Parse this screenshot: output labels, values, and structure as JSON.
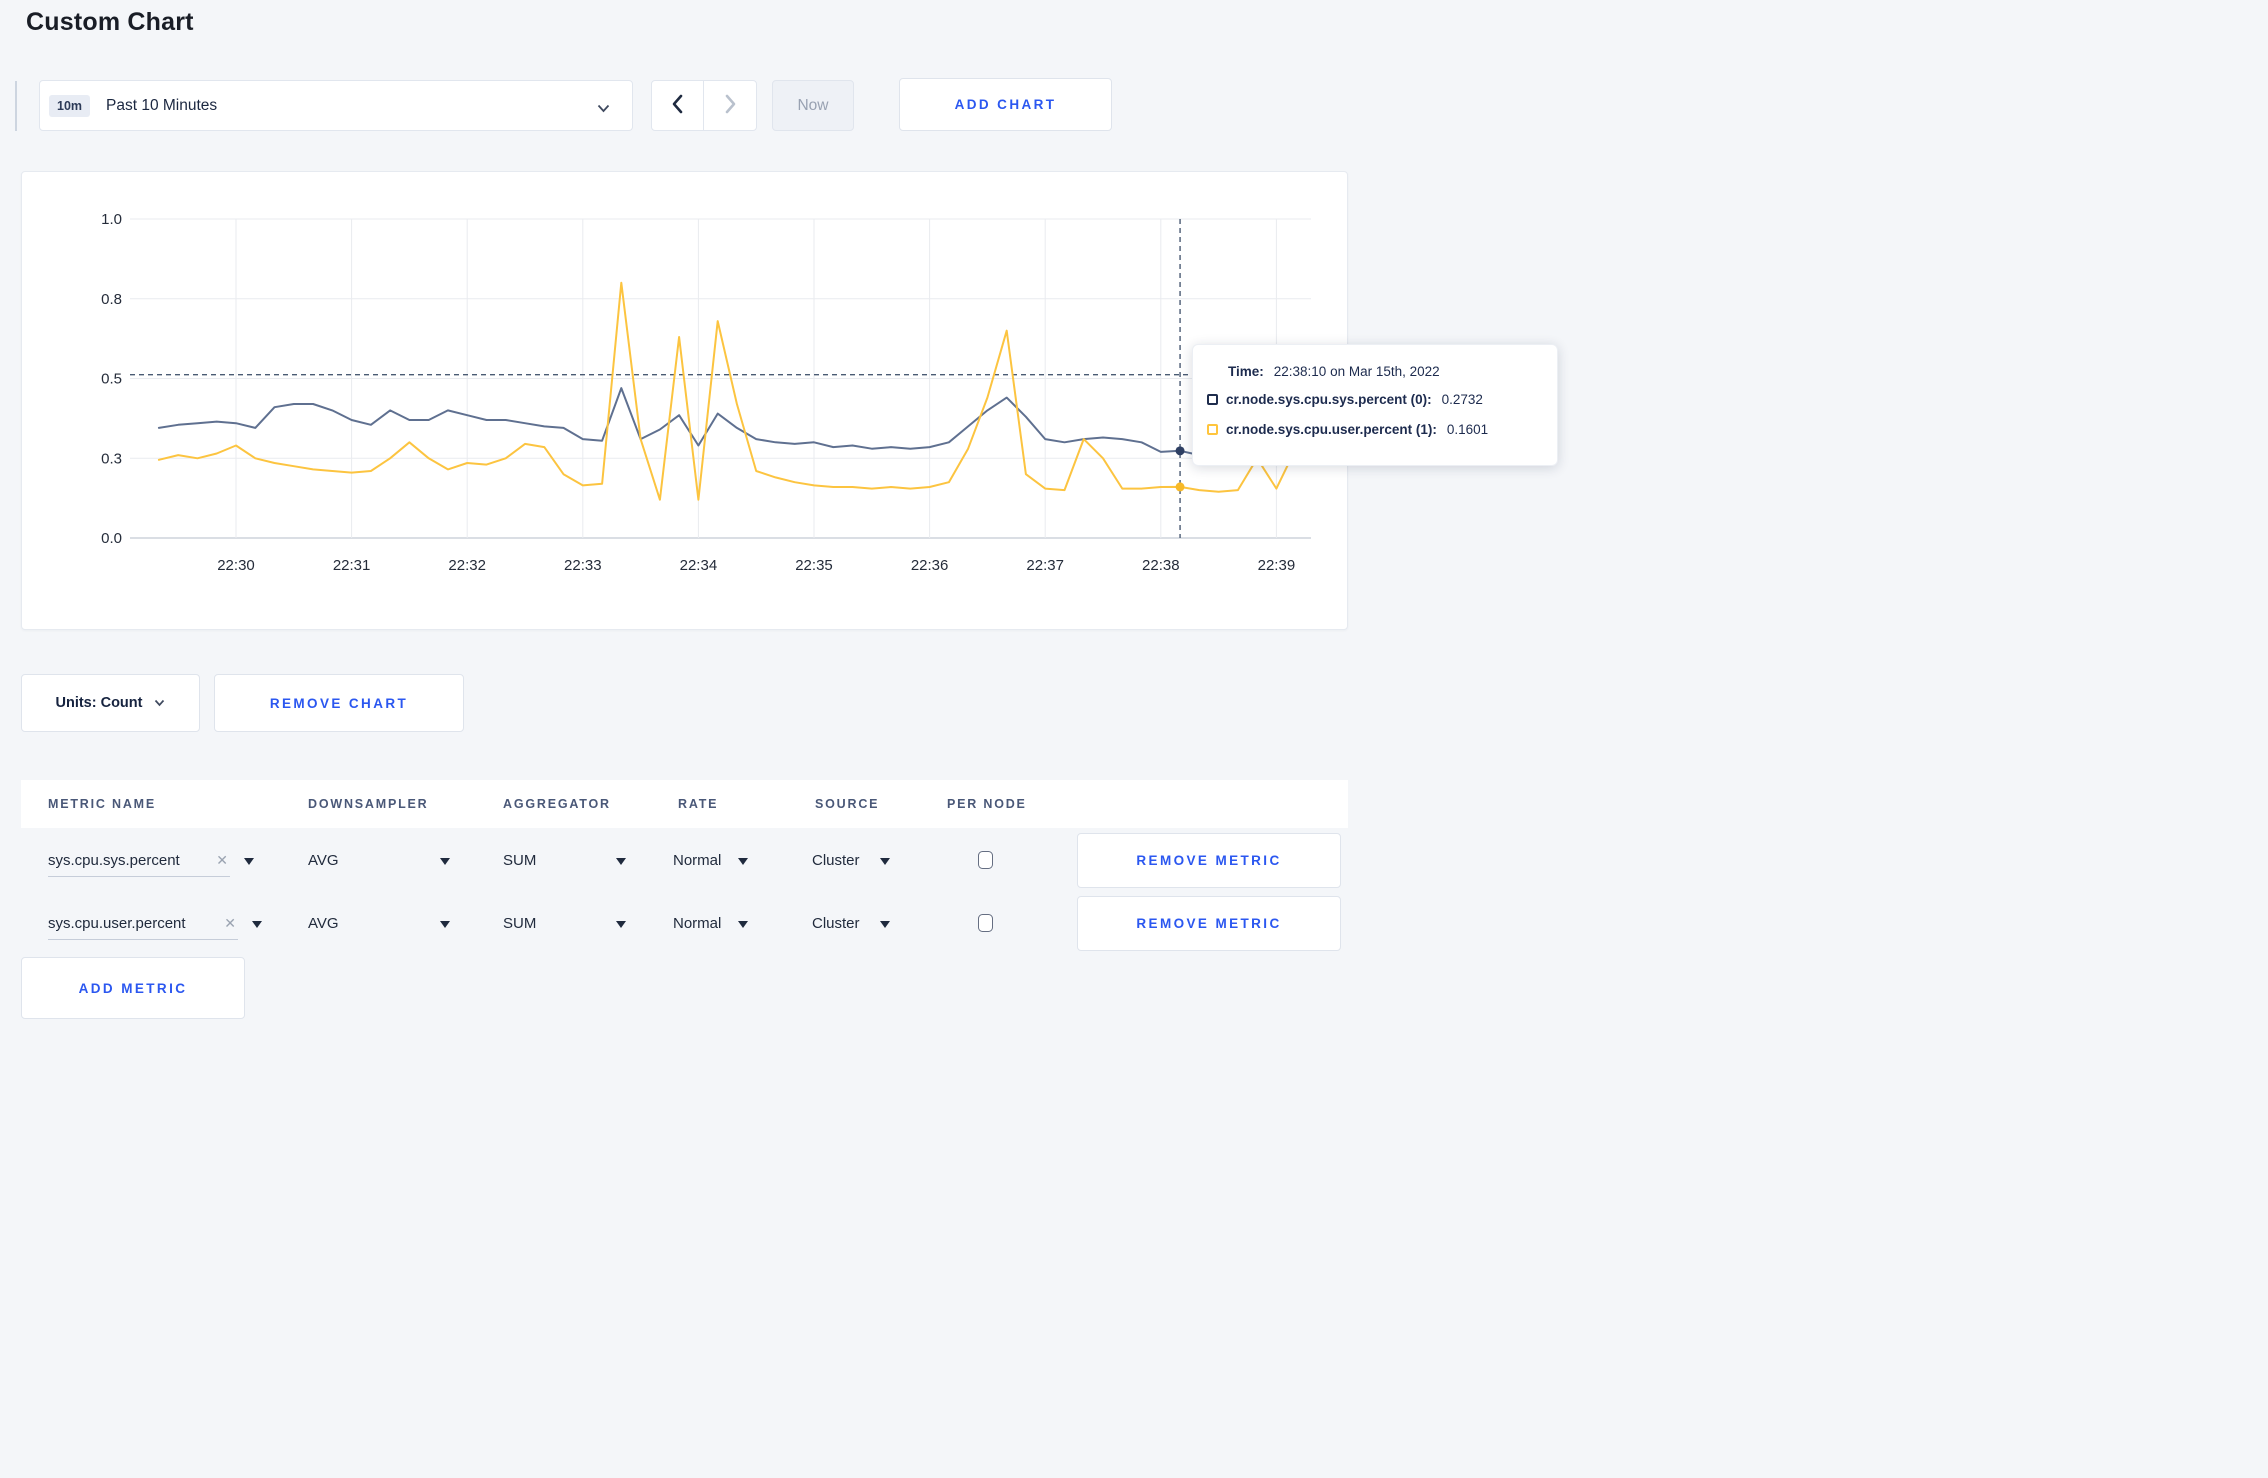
{
  "page": {
    "title": "Custom Chart"
  },
  "toolbar": {
    "range_badge": "10m",
    "range_label": "Past 10 Minutes",
    "now_label": "Now",
    "add_chart_label": "ADD CHART"
  },
  "chart": {
    "tooltip": {
      "time_label": "Time:",
      "time_value": "22:38:10 on Mar 15th, 2022",
      "series": [
        {
          "label": "cr.node.sys.cpu.sys.percent (0):",
          "value": "0.2732",
          "color": "#1f2d4d"
        },
        {
          "label": "cr.node.sys.cpu.user.percent (1):",
          "value": "0.1601",
          "color": "#ffc53d"
        }
      ]
    }
  },
  "chart_data": {
    "type": "line",
    "title": "",
    "xlabel": "",
    "ylabel": "",
    "ylim": [
      0,
      1
    ],
    "grid": true,
    "x_ticks": [
      "22:30",
      "22:31",
      "22:32",
      "22:33",
      "22:34",
      "22:35",
      "22:36",
      "22:37",
      "22:38",
      "22:39"
    ],
    "y_ticks": [
      "0.0",
      "0.3",
      "0.5",
      "0.8",
      "1.0"
    ],
    "y_tick_values": [
      0,
      0.25,
      0.5,
      0.75,
      1.0
    ],
    "x_start_time": "22:29:20",
    "x_step_seconds": 10,
    "first_tick_index": 4,
    "points_per_tick": 6,
    "series": [
      {
        "name": "cr.node.sys.cpu.sys.percent",
        "color": "#5f7090",
        "dot_color": "#2e3f63",
        "values": [
          0.345,
          0.355,
          0.36,
          0.365,
          0.36,
          0.345,
          0.41,
          0.42,
          0.42,
          0.4,
          0.37,
          0.355,
          0.4,
          0.37,
          0.37,
          0.4,
          0.385,
          0.37,
          0.37,
          0.36,
          0.35,
          0.345,
          0.31,
          0.305,
          0.47,
          0.31,
          0.34,
          0.385,
          0.29,
          0.39,
          0.345,
          0.31,
          0.3,
          0.295,
          0.3,
          0.285,
          0.29,
          0.28,
          0.285,
          0.28,
          0.285,
          0.3,
          0.35,
          0.4,
          0.44,
          0.38,
          0.31,
          0.3,
          0.31,
          0.315,
          0.31,
          0.3,
          0.27,
          0.2732,
          0.26,
          0.27,
          0.285,
          0.29,
          0.285,
          0.3
        ]
      },
      {
        "name": "cr.node.sys.cpu.user.percent",
        "color": "#fcc440",
        "dot_color": "#f7b928",
        "values": [
          0.245,
          0.26,
          0.25,
          0.265,
          0.29,
          0.25,
          0.235,
          0.225,
          0.215,
          0.21,
          0.205,
          0.21,
          0.25,
          0.3,
          0.25,
          0.215,
          0.235,
          0.23,
          0.25,
          0.295,
          0.285,
          0.2,
          0.165,
          0.17,
          0.8,
          0.31,
          0.12,
          0.63,
          0.12,
          0.68,
          0.42,
          0.21,
          0.19,
          0.175,
          0.165,
          0.16,
          0.16,
          0.155,
          0.16,
          0.155,
          0.16,
          0.175,
          0.28,
          0.44,
          0.65,
          0.2,
          0.155,
          0.15,
          0.31,
          0.25,
          0.155,
          0.155,
          0.16,
          0.1601,
          0.15,
          0.145,
          0.15,
          0.25,
          0.155,
          0.28
        ]
      }
    ],
    "crosshair": {
      "index": 53,
      "time": "22:38:10",
      "hover_value": 0.512,
      "values": [
        0.2732,
        0.1601
      ]
    },
    "legend_position": "tooltip"
  },
  "chart_footer": {
    "units_label": "Units: Count",
    "remove_chart_label": "REMOVE CHART"
  },
  "metrics_table": {
    "headers": [
      "METRIC NAME",
      "DOWNSAMPLER",
      "AGGREGATOR",
      "RATE",
      "SOURCE",
      "PER NODE"
    ],
    "rows": [
      {
        "metric": "sys.cpu.sys.percent",
        "downsampler": "AVG",
        "aggregator": "SUM",
        "rate": "Normal",
        "source": "Cluster",
        "per_node_checked": false,
        "remove_label": "REMOVE METRIC"
      },
      {
        "metric": "sys.cpu.user.percent",
        "downsampler": "AVG",
        "aggregator": "SUM",
        "rate": "Normal",
        "source": "Cluster",
        "per_node_checked": false,
        "remove_label": "REMOVE METRIC"
      }
    ],
    "add_metric_label": "ADD METRIC"
  },
  "colors": {
    "accent_blue": "#2b57f0",
    "page_background": "#f4f6f9",
    "card_background": "#ffffff",
    "gridline": "#e9ebef",
    "axis_line": "#ced3db",
    "crosshair": "#4a5b73"
  }
}
